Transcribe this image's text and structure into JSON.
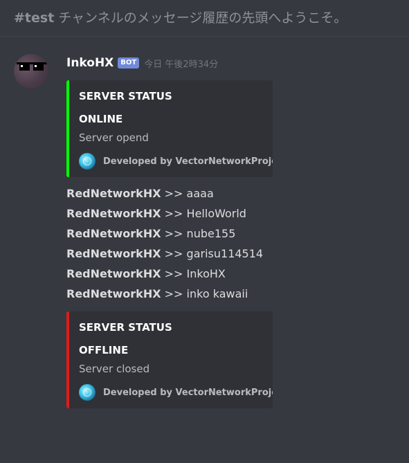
{
  "channel_header": {
    "channel_name": "#test",
    "welcome_text": "チャンネルのメッセージ履歴の先頭へようこそ。"
  },
  "message": {
    "author": "InkoHX",
    "bot_tag": "BOT",
    "timestamp": "今日 午後2時34分",
    "embeds": [
      {
        "title": "SERVER STATUS",
        "field_name": "ONLINE",
        "field_value": "Server opend",
        "footer": "Developed by VectorNetworkProject",
        "color": "#00ff00"
      },
      {
        "title": "SERVER STATUS",
        "field_name": "OFFLINE",
        "field_value": "Server closed",
        "footer": "Developed by VectorNetworkProject",
        "color": "#e01b1b"
      }
    ],
    "lines": [
      {
        "author": "RedNetworkHX",
        "sep": ">>",
        "text": "aaaa"
      },
      {
        "author": "RedNetworkHX",
        "sep": ">>",
        "text": "HelloWorld"
      },
      {
        "author": "RedNetworkHX",
        "sep": ">>",
        "text": "nube155"
      },
      {
        "author": "RedNetworkHX",
        "sep": ">>",
        "text": "garisu114514"
      },
      {
        "author": "RedNetworkHX",
        "sep": ">>",
        "text": "InkoHX"
      },
      {
        "author": "RedNetworkHX",
        "sep": ">>",
        "text": "inko kawaii"
      }
    ]
  },
  "icons": {
    "avatar": "avatar-image",
    "footer": "globe-icon"
  }
}
